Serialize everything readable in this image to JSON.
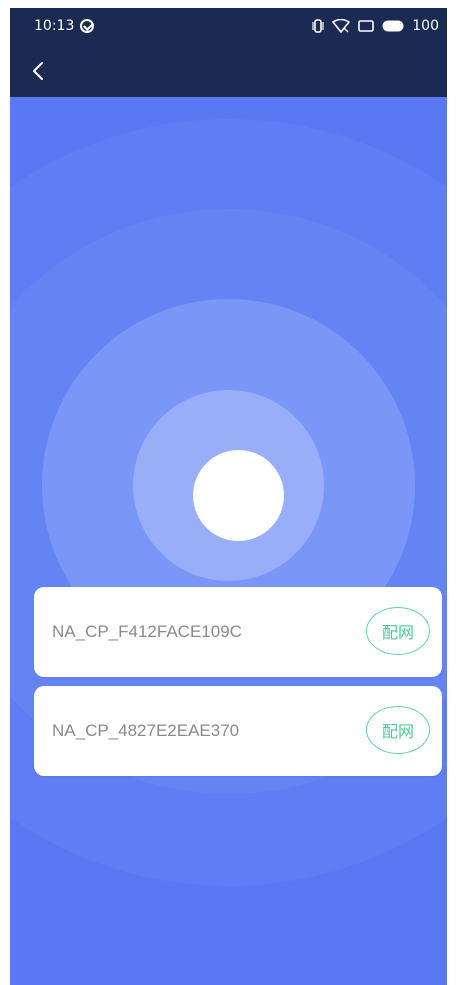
{
  "status_bar": {
    "time": "10:13",
    "battery": "100"
  },
  "devices": [
    {
      "name": "NA_CP_F412FACE109C",
      "action": "配网"
    },
    {
      "name": "NA_CP_4827E2EAE370",
      "action": "配网"
    }
  ],
  "colors": {
    "header_bg": "#1b2a52",
    "page_bg": "#5a78f2",
    "accent": "#4cc89a"
  }
}
